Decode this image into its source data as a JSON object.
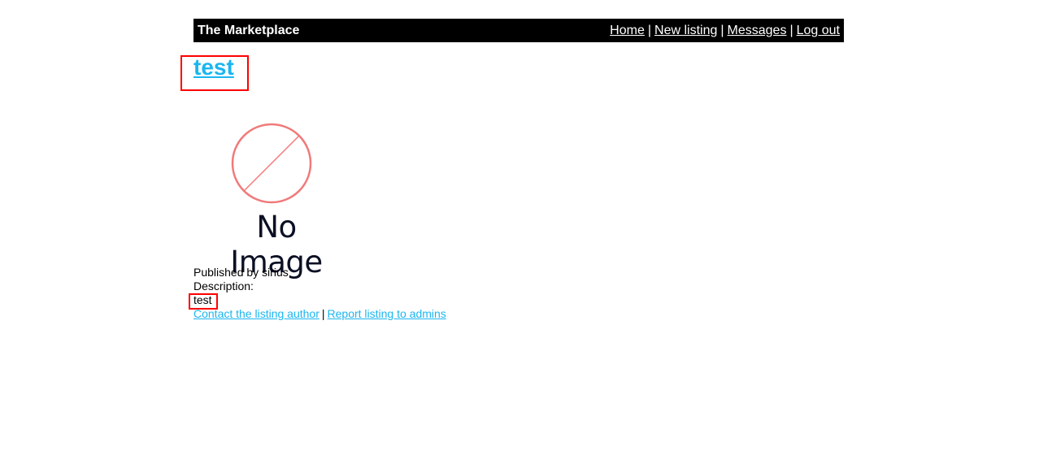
{
  "header": {
    "brand": "The Marketplace",
    "nav": {
      "home": "Home",
      "new_listing": "New listing",
      "messages": "Messages",
      "log_out": "Log out",
      "separator": "|"
    }
  },
  "listing": {
    "title": "test",
    "image_placeholder_text": "No Image",
    "published_by": "Published by sirius",
    "description_label": "Description:",
    "description": "test",
    "contact_link": "Contact the listing author",
    "report_link": "Report listing to admins",
    "links_separator": "|"
  },
  "colors": {
    "header_bg": "#000000",
    "link": "#1ab6f0",
    "highlight_box": "#ff0000",
    "no_image_circle": "#f07a7a"
  }
}
